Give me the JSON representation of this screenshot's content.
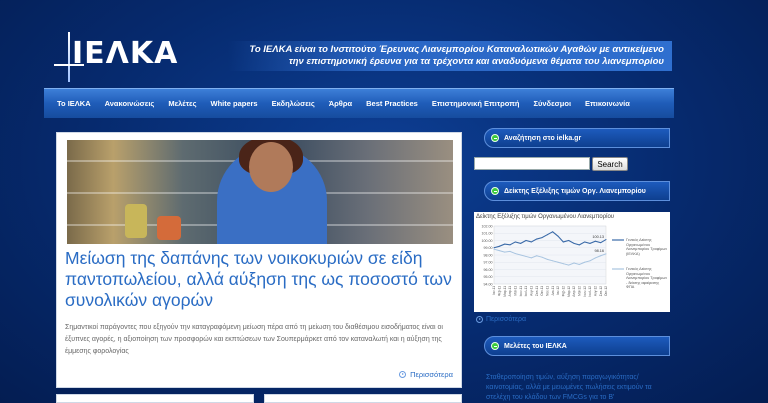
{
  "header": {
    "logo_text": "ΙΕΛΚΑ",
    "tagline_line1": "Το ΙΕΛΚΑ είναι το Ινστιτούτο Έρευνας Λιανεμπορίου Καταναλωτικών Αγαθών με αντικείμενο",
    "tagline_line2": "την επιστημονική έρευνα για τα τρέχοντα και αναδυόμενα θέματα του λιανεμπορίου"
  },
  "nav": {
    "items": [
      "Το ΙΕΛΚΑ",
      "Ανακοινώσεις",
      "Μελέτες",
      "White papers",
      "Εκδηλώσεις",
      "Άρθρα",
      "Best Practices",
      "Επιστημονική Επιτροπή",
      "Σύνδεσμοι",
      "Επικοινωνία"
    ]
  },
  "main": {
    "headline": "Μείωση της δαπάνης των νοικοκυριών σε είδη παντοπωλείου, αλλά αύξηση της ως ποσοστό των συνολικών αγορών",
    "summary": "Σημαντικοί παράγοντες που εξηγούν την καταγραφόμενη μείωση πέρα από τη μείωση του διαθέσιμου εισοδήματος είναι οι έξυπνες αγορές, η αξιοποίηση των προσφορών και εκπτώσεων των Σουπερμάρκετ από τον καταναλωτή και η αύξηση της έμμεσης φορολογίας",
    "more_label": "Περισσότερα"
  },
  "sidebar": {
    "search_title": "Αναζήτηση στο ielka.gr",
    "search_placeholder": "",
    "search_button": "Search",
    "price_title": "Δείκτης Εξέλιξης τιμών Οργ. Λιανεμπορίου",
    "chart_more": "Περισσότερα",
    "studies_title": "Μελέτες του ΙΕΛΚΑ",
    "studies_item": "Σταθεροποίηση τιμών, αύξηση παραγωγικότητας/καινοτομίας, αλλά με μειωμένες πωλήσεις εκτιμούν τα στελέχη του κλάδου των FMCGs για το Β'"
  },
  "colors": {
    "accent": "#2a6cc4",
    "nav_bg": "#1f5cb8",
    "page_bg": "#062a6e",
    "series_dark": "#3a6aa8",
    "series_light": "#a8c4e0"
  },
  "chart_data": {
    "type": "line",
    "title": "Δείκτης Εξέλιξης τιμών Οργανωμένου Λιανεμπορίου",
    "y_ticks": [
      "102.00",
      "101.00",
      "100.00",
      "99.00",
      "98.00",
      "97.00",
      "96.00",
      "95.00",
      "94.00"
    ],
    "ylim": [
      94,
      102
    ],
    "x_ticks": [
      "Ιαν-11",
      "Φεβ-11",
      "Μαρ-11",
      "Απρ-11",
      "Μαϊ-11",
      "Ιουν-11",
      "Ιουλ-11",
      "Αυγ-11",
      "Σεπ-11",
      "Οκτ-11",
      "Νοε-11",
      "Δεκ-11",
      "Ιαν-12",
      "Φεβ-12",
      "Μαρ-12",
      "Απρ-12",
      "Μαϊ-12",
      "Ιουν-12",
      "Ιουλ-12",
      "Αυγ-12",
      "Σεπ-12",
      "Οκτ-12"
    ],
    "series": [
      {
        "name": "Γενικός Δείκτης Οργανωμένου Λιανεμπορίου Τροφίμων (ΙΕΛΚΑ)",
        "values": [
          99.0,
          99.2,
          99.5,
          99.4,
          99.8,
          99.6,
          100.0,
          99.8,
          100.2,
          100.4,
          100.8,
          101.2,
          100.6,
          99.8,
          100.0,
          99.6,
          99.4,
          99.8,
          99.6,
          99.9,
          99.7,
          100.13
        ],
        "end_label": "100.13"
      },
      {
        "name": "Γενικός Δείκτης Οργανωμένου Λιανεμπορίου Τροφίμων - δείκτης αφαίρεσης ΦΠΑ",
        "values": [
          98.8,
          98.6,
          98.4,
          98.5,
          98.2,
          98.0,
          97.8,
          97.6,
          97.9,
          97.7,
          97.4,
          97.2,
          97.0,
          96.8,
          96.6,
          96.9,
          96.7,
          97.0,
          97.2,
          97.6,
          97.9,
          98.16
        ],
        "end_label": "98.16"
      }
    ]
  }
}
